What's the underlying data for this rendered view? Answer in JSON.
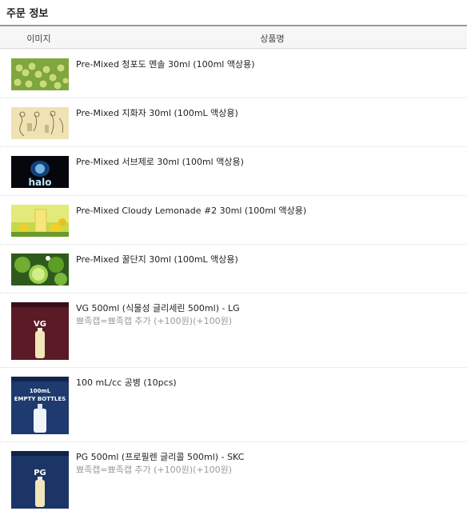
{
  "section": {
    "title": "주문 정보"
  },
  "table": {
    "col_image": "이미지",
    "col_name": "상품명"
  },
  "products": [
    {
      "name": "Pre-Mixed 청포도 멘솔 30ml (100ml 액상용)",
      "option": "",
      "thumb": "green-grapes"
    },
    {
      "name": "Pre-Mixed 지화자 30ml (100mL 액상용)",
      "option": "",
      "thumb": "korean-painting"
    },
    {
      "name": "Pre-Mixed 서브제로 30ml (100ml 액상용)",
      "option": "",
      "thumb": "halo-logo",
      "thumb_text": "halo"
    },
    {
      "name": "Pre-Mixed Cloudy Lemonade #2 30ml (100ml 액상용)",
      "option": "",
      "thumb": "lemonade"
    },
    {
      "name": "Pre-Mixed 꿀단지 30ml (100mL 액상용)",
      "option": "",
      "thumb": "limes"
    },
    {
      "name": "VG 500ml (식물성 글리세린 500ml) - LG",
      "option": "뾰족캡=뾰족캡 추가 (+100원)(+100원)",
      "thumb": "vg-bottle",
      "thumb_text": "VG"
    },
    {
      "name": "100 mL/cc 공병 (10pcs)",
      "option": "",
      "thumb": "empty-bottle",
      "thumb_text_1": "100mL",
      "thumb_text_2": "EMPTY BOTTLES"
    },
    {
      "name": "PG 500ml (프로필렌 글리콜 500ml) - SKC",
      "option": "뾰족캡=뾰족캡 추가 (+100원)(+100원)",
      "thumb": "pg-bottle",
      "thumb_text": "PG"
    }
  ]
}
